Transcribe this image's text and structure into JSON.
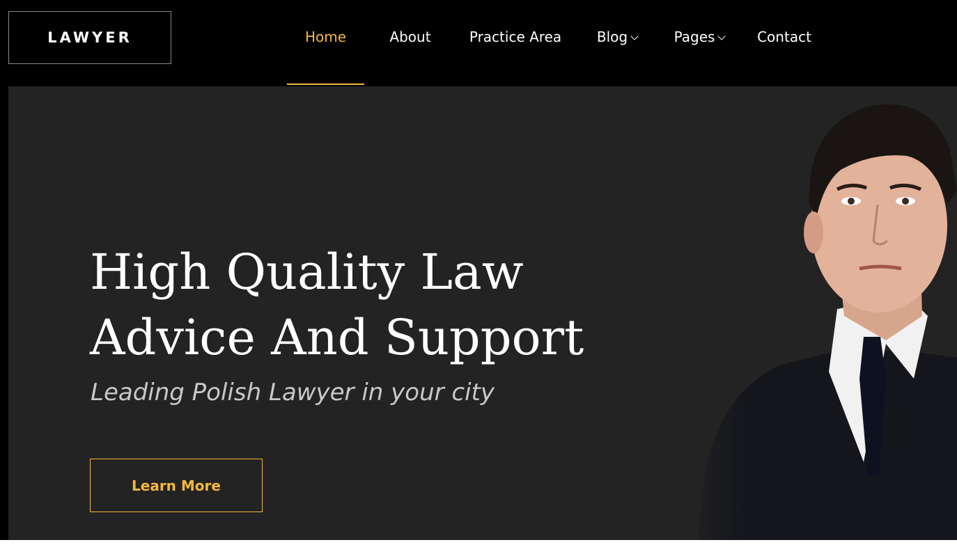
{
  "brand": {
    "logo_text": "LAWYER"
  },
  "nav": {
    "items": [
      {
        "label": "Home",
        "active": true
      },
      {
        "label": "About"
      },
      {
        "label": "Practice Area"
      },
      {
        "label": "Blog",
        "dropdown": true
      },
      {
        "label": "Pages",
        "dropdown": true
      },
      {
        "label": "Contact"
      }
    ]
  },
  "hero": {
    "title_line1": "High Quality Law",
    "title_line2": "Advice And Support",
    "subtitle": "Leading Polish Lawyer in your city",
    "cta_label": "Learn More",
    "image": "lawyer-portrait"
  },
  "colors": {
    "accent": "#f5b83d",
    "nav_bg": "#000000",
    "hero_bg": "#232323",
    "text": "#ffffff",
    "subtitle": "#c8c8c8"
  }
}
